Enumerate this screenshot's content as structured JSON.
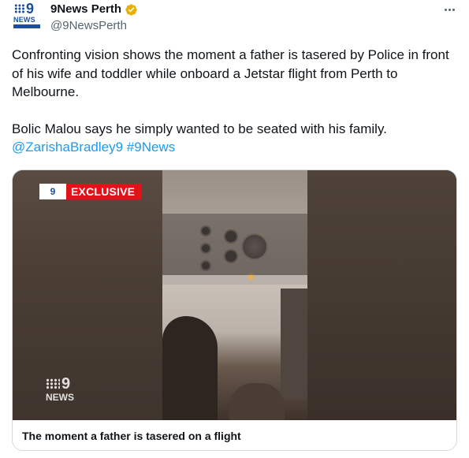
{
  "account": {
    "display_name": "9News Perth",
    "handle": "@9NewsPerth",
    "verified": true,
    "avatar_logo_text": "NEWS",
    "avatar_logo_numeral": "9"
  },
  "tweet": {
    "paragraph1": "Confronting vision shows the moment a father is tasered by Police in front of his wife and toddler while onboard a Jetstar flight from Perth to Melbourne.",
    "paragraph2_text": "Bolic Malou says he simply wanted to be seated with his family.",
    "mention": "@ZarishaBradley9",
    "hashtag": "#9News"
  },
  "media": {
    "badge_logo": "9",
    "badge_label": "EXCLUSIVE",
    "watermark_numeral": "9",
    "watermark_text": "NEWS",
    "caption": "The moment a father is tasered on a flight"
  },
  "icons": {
    "verified": "verified-badge-icon",
    "more": "more-options-icon"
  },
  "colors": {
    "link": "#1d9bf0",
    "verified": "#e8b100",
    "badge_red": "#e0121a",
    "brand_blue": "#1a4fa0"
  }
}
